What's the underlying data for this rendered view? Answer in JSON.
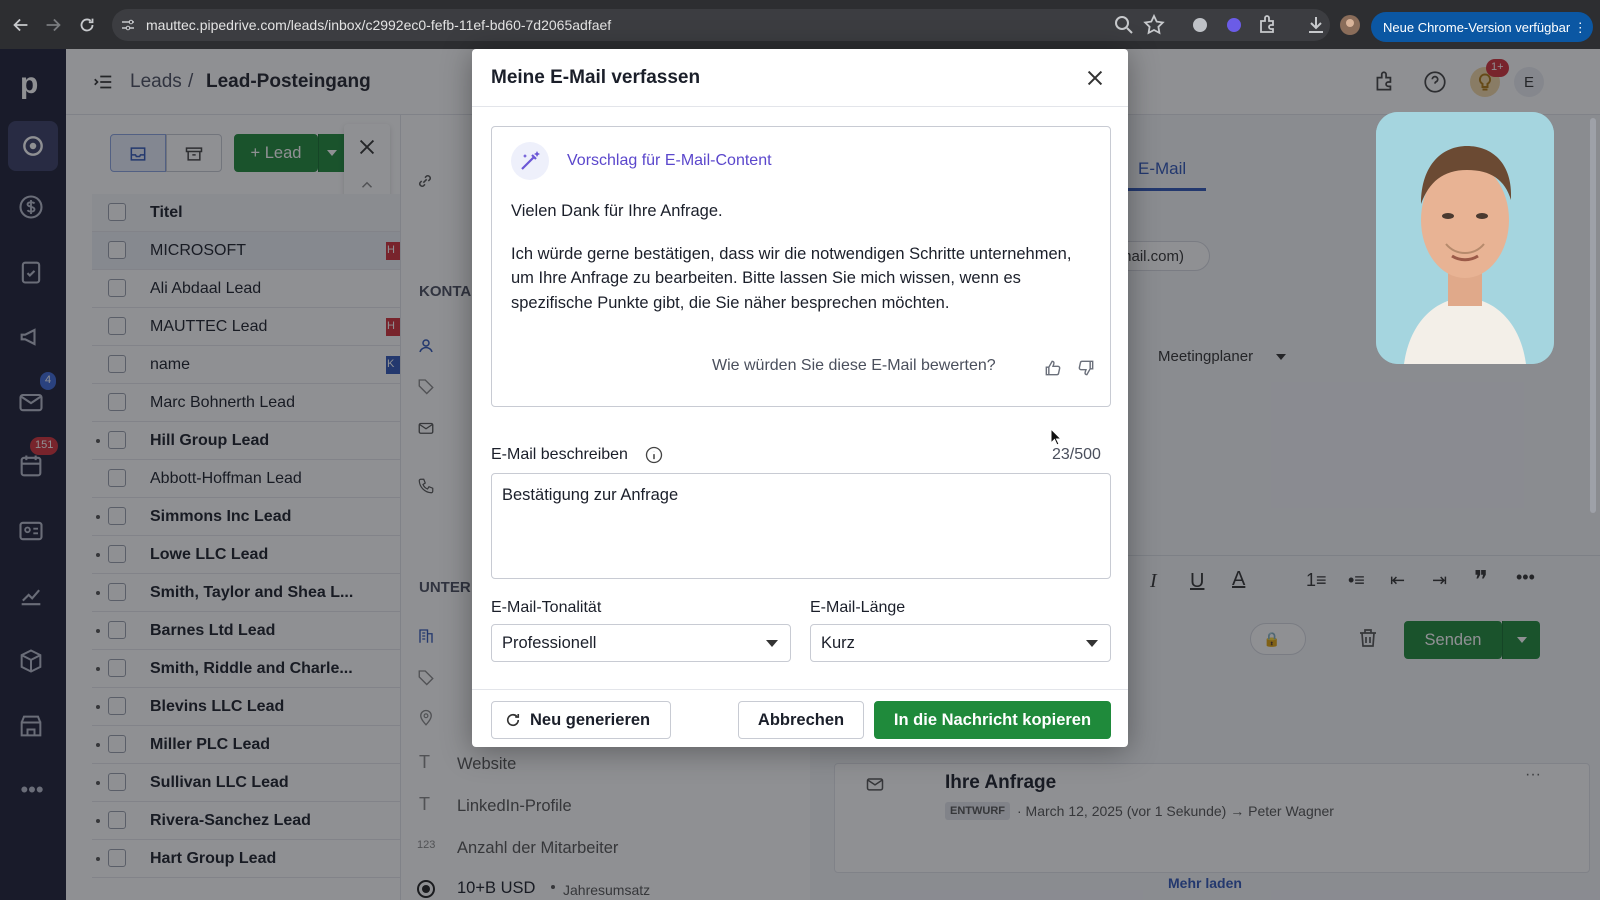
{
  "browser": {
    "url": "mauttec.pipedrive.com/leads/inbox/c2992ec0-fefb-11ef-bd60-7d2065adfaef",
    "update_label": "Neue Chrome-Version verfügbar"
  },
  "sidebar": {
    "mail_badge": "4",
    "activities_badge": "151"
  },
  "header": {
    "crumb_root": "Leads",
    "crumb_sep": "/",
    "crumb_current": "Lead-Posteingang",
    "notif_badge": "1+",
    "avatar_initial": "E"
  },
  "leads_toolbar": {
    "add_lead_label": "+ Lead"
  },
  "leads_list": {
    "column_title": "Titel",
    "rows": [
      {
        "title": "MICROSOFT",
        "tag": "H",
        "bold": false,
        "dot": false
      },
      {
        "title": "Ali Abdaal Lead",
        "tag": "",
        "bold": false,
        "dot": false
      },
      {
        "title": "MAUTTEC Lead",
        "tag": "H",
        "bold": false,
        "dot": false
      },
      {
        "title": "name",
        "tag": "K",
        "bold": false,
        "dot": false
      },
      {
        "title": "Marc Bohnerth Lead",
        "tag": "",
        "bold": false,
        "dot": false
      },
      {
        "title": "Hill Group Lead",
        "tag": "",
        "bold": true,
        "dot": true
      },
      {
        "title": "Abbott-Hoffman Lead",
        "tag": "",
        "bold": false,
        "dot": false
      },
      {
        "title": "Simmons Inc Lead",
        "tag": "",
        "bold": true,
        "dot": true
      },
      {
        "title": "Lowe LLC Lead",
        "tag": "",
        "bold": true,
        "dot": true
      },
      {
        "title": "Smith, Taylor and Shea L...",
        "tag": "",
        "bold": true,
        "dot": true
      },
      {
        "title": "Barnes Ltd Lead",
        "tag": "",
        "bold": true,
        "dot": true
      },
      {
        "title": "Smith, Riddle and Charle...",
        "tag": "",
        "bold": true,
        "dot": true
      },
      {
        "title": "Blevins LLC Lead",
        "tag": "",
        "bold": true,
        "dot": true
      },
      {
        "title": "Miller PLC Lead",
        "tag": "",
        "bold": true,
        "dot": true
      },
      {
        "title": "Sullivan LLC Lead",
        "tag": "",
        "bold": true,
        "dot": true
      },
      {
        "title": "Rivera-Sanchez Lead",
        "tag": "",
        "bold": true,
        "dot": true
      },
      {
        "title": "Hart Group Lead",
        "tag": "",
        "bold": true,
        "dot": true
      }
    ]
  },
  "detail": {
    "kontakt_label": "KONTA",
    "unternehmen_label": "UNTER",
    "field_website": "Website",
    "field_linkedin": "LinkedIn-Profile",
    "field_employees": "Anzahl der Mitarbeiter",
    "revenue_value": "10+B USD",
    "revenue_label": "Jahresumsatz"
  },
  "right_panel": {
    "tab_email": "E-Mail",
    "email_hint": "mail.com)",
    "meetingplaner": "Meetingplaner",
    "send_label": "Senden",
    "activity_title": "Ihre Anfrage",
    "activity_badge": "ENTWURF",
    "activity_meta": "· March 12, 2025 (vor 1 Sekunde) → Peter Wagner",
    "load_more": "Mehr laden"
  },
  "modal": {
    "title": "Meine E-Mail verfassen",
    "suggestion_heading": "Vorschlag für E-Mail-Content",
    "suggestion_p1": "Vielen Dank für Ihre Anfrage.",
    "suggestion_p2": "Ich würde gerne bestätigen, dass wir die notwendigen Schritte unternehmen, um Ihre Anfrage zu bearbeiten. Bitte lassen Sie mich wissen, wenn es spezifische Punkte gibt, die Sie näher besprechen möchten.",
    "rating_question": "Wie würden Sie diese E-Mail bewerten?",
    "describe_label": "E-Mail beschreiben",
    "char_count": "23/500",
    "describe_value": "Bestätigung zur Anfrage",
    "tone_label": "E-Mail-Tonalität",
    "tone_value": "Professionell",
    "length_label": "E-Mail-Länge",
    "length_value": "Kurz",
    "regenerate_label": "Neu generieren",
    "cancel_label": "Abbrechen",
    "copy_label": "In die Nachricht kopieren"
  },
  "colors": {
    "primary_green": "#1f8a3b",
    "accent_purple": "#5b47cc",
    "sidebar_bg": "#1d2036",
    "badge_red": "#d3313a"
  }
}
